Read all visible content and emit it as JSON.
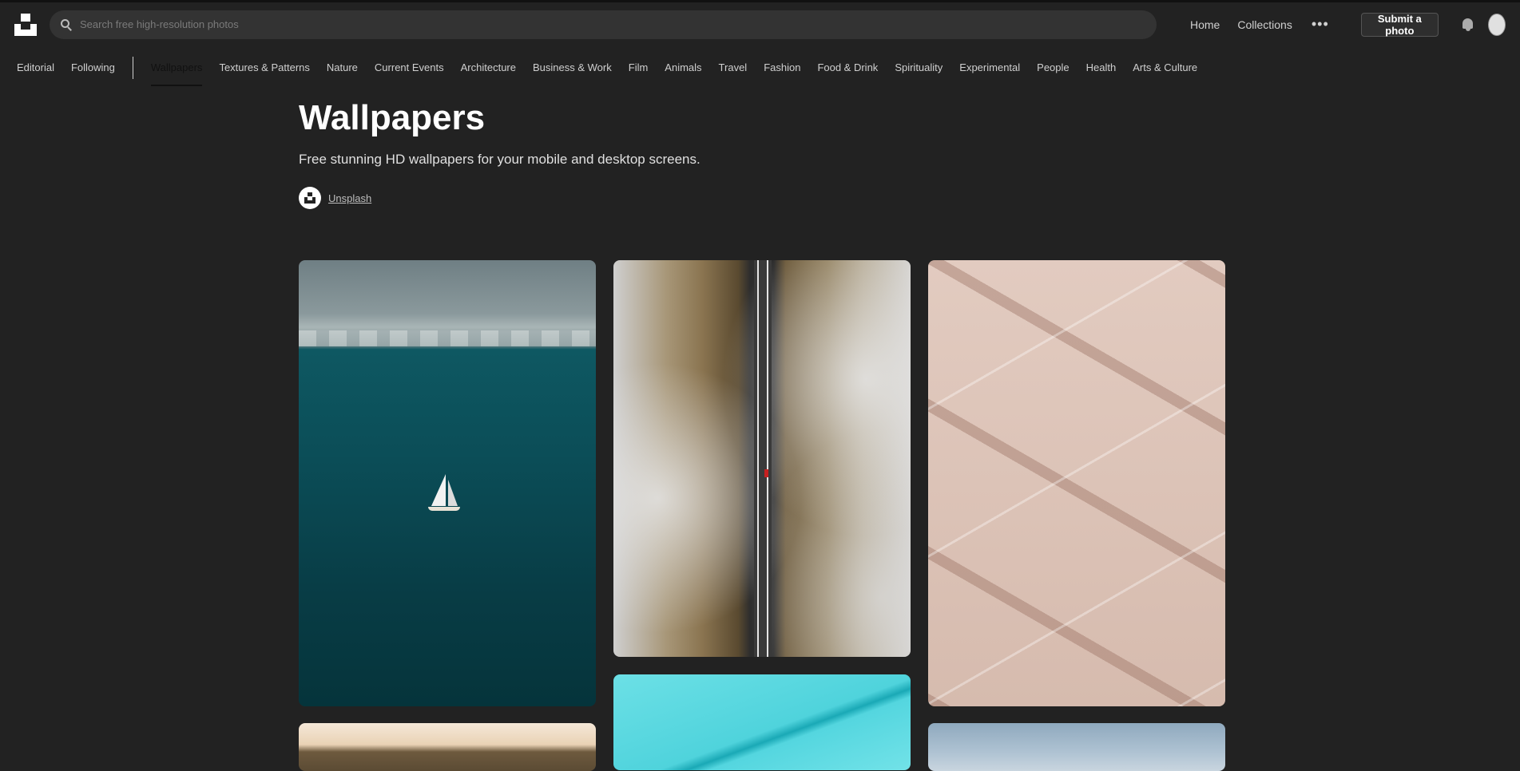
{
  "search": {
    "placeholder": "Search free high-resolution photos"
  },
  "header": {
    "nav": [
      "Home",
      "Collections"
    ],
    "more": "•••",
    "submit_label": "Submit a photo"
  },
  "categories": {
    "left": [
      "Editorial",
      "Following"
    ],
    "topics": [
      "Wallpapers",
      "Textures & Patterns",
      "Nature",
      "Current Events",
      "Architecture",
      "Business & Work",
      "Film",
      "Animals",
      "Travel",
      "Fashion",
      "Food & Drink",
      "Spirituality",
      "Experimental",
      "People",
      "Health",
      "Arts & Culture"
    ],
    "active": "Wallpapers"
  },
  "hero": {
    "title": "Wallpapers",
    "description": "Free stunning HD wallpapers for your mobile and desktop screens.",
    "credit": "Unsplash"
  },
  "icons": [
    "unsplash-logo-icon",
    "search-icon",
    "more-icon",
    "bell-icon",
    "avatar"
  ],
  "colors": {
    "background": "#222222",
    "text": "#ffffff"
  }
}
